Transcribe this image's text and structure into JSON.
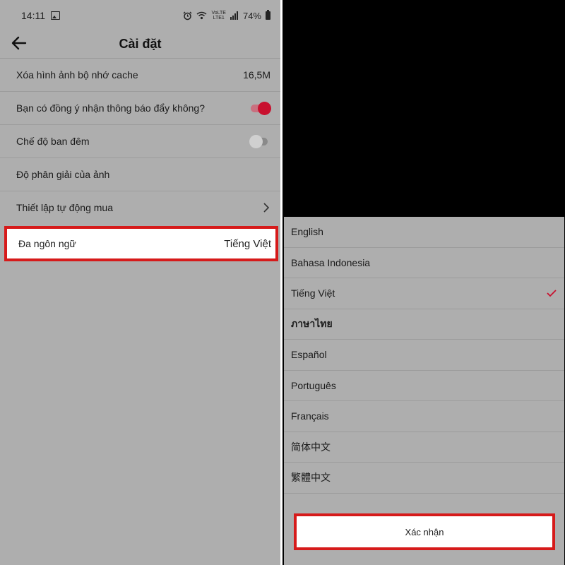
{
  "status_bar": {
    "time": "14:11",
    "lte_top": "VoLTE",
    "lte_bottom": "LTE1",
    "battery": "74%"
  },
  "settings": {
    "title": "Cài đặt",
    "rows": [
      {
        "label": "Xóa hình ảnh bộ nhớ cache",
        "value": "16,5M"
      },
      {
        "label": "Bạn có đồng ý nhận thông báo đẩy không?",
        "toggle": "on"
      },
      {
        "label": "Chế độ ban đêm",
        "toggle": "off"
      },
      {
        "label": "Độ phân giải của ảnh"
      },
      {
        "label": "Thiết lập tự động mua"
      }
    ],
    "language_row": {
      "label": "Đa ngôn ngữ",
      "value": "Tiếng Việt"
    }
  },
  "languages": {
    "items": [
      "English",
      "Bahasa Indonesia",
      "Tiếng Việt",
      "ภาษาไทย",
      "Español",
      "Português",
      "Français",
      "简体中文",
      "繁體中文"
    ],
    "selected": "Tiếng Việt",
    "confirm_label": "Xác nhận"
  },
  "colors": {
    "accent": "#c8102e",
    "highlight_border": "#d61a1a",
    "overlay": "#aeaeae"
  }
}
